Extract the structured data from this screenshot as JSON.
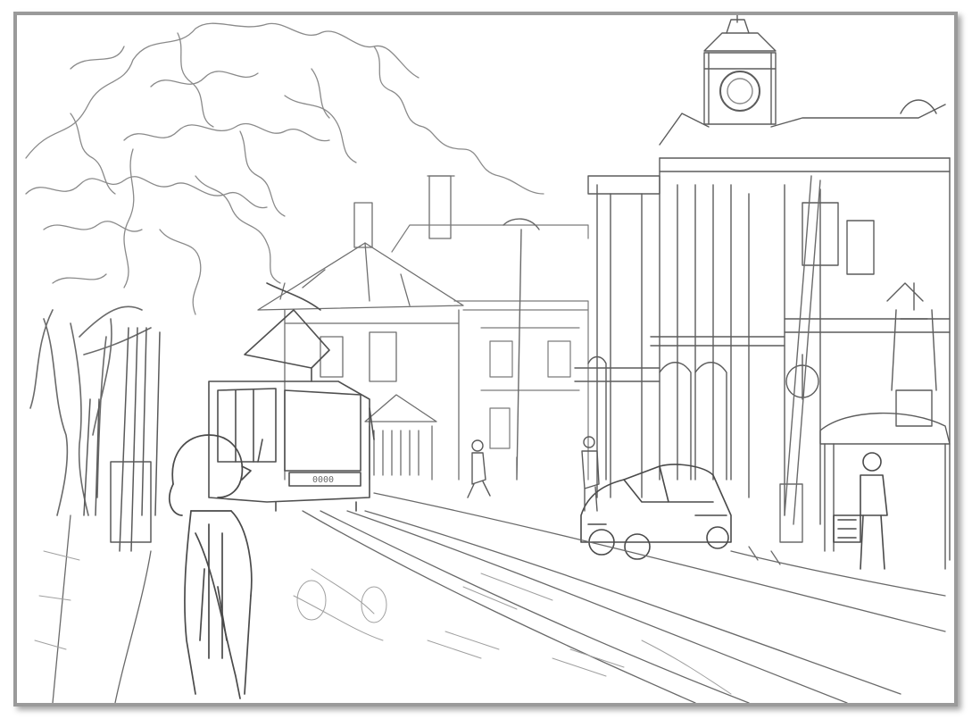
{
  "artwork": {
    "medium": "pencil sketch",
    "paper_color": "#ffffff",
    "frame_color": "#9a9a9a",
    "stroke_color": "#5a5a5a",
    "stroke_light": "#9c9c9c",
    "tram_number": "0000"
  }
}
